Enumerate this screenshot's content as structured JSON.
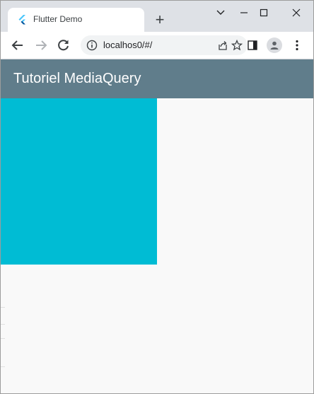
{
  "browser": {
    "tab_title": "Flutter Demo",
    "url": "localhos0/#/"
  },
  "icons": {
    "favicon": "flutter-logo-icon",
    "new_tab": "plus-icon",
    "minimize": "minimize-icon",
    "maximize": "maximize-icon",
    "close": "close-icon",
    "dropdown": "chevron-down-icon",
    "back": "back-arrow-icon",
    "forward": "forward-arrow-icon",
    "reload": "reload-icon",
    "site_info": "info-icon",
    "share": "share-icon",
    "bookmark": "star-icon",
    "side_panel": "side-panel-icon",
    "profile": "profile-avatar-icon",
    "menu": "kebab-menu-icon"
  },
  "app": {
    "title": "Tutoriel MediaQuery",
    "appbar_color": "#607d8b",
    "box_color": "#00bcd4",
    "background_color": "#f9f9f9"
  }
}
